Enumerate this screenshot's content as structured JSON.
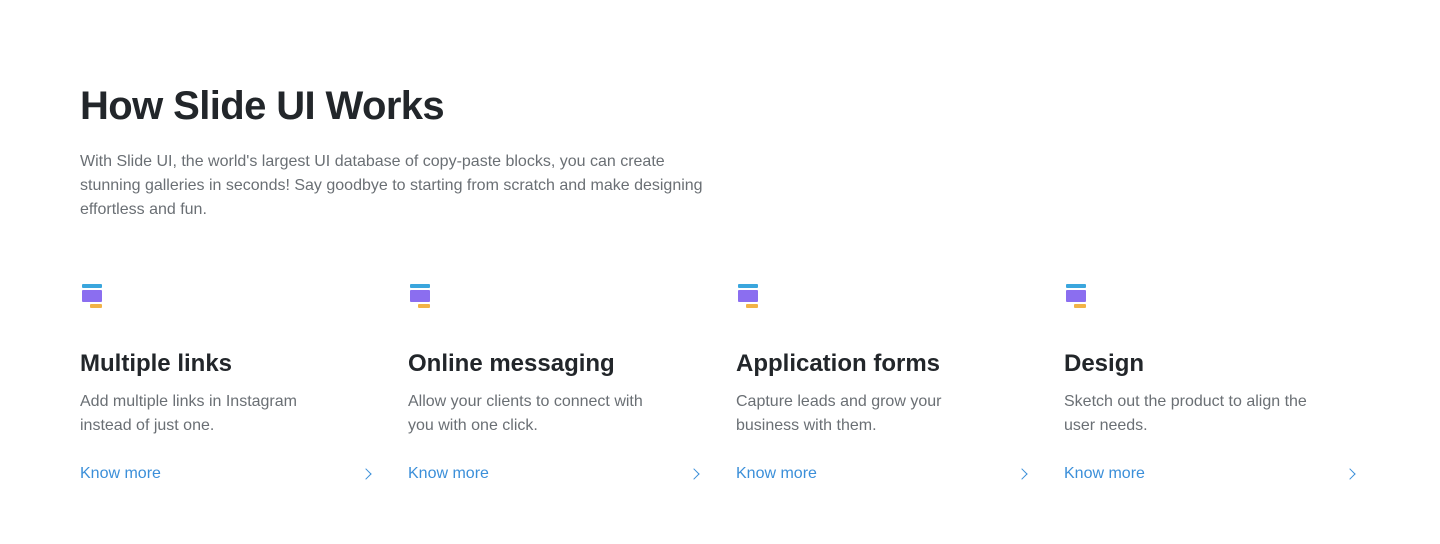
{
  "colors": {
    "link": "#3b8fd9",
    "icon_top": "#3aa6dd",
    "icon_block": "#8b6ef0",
    "icon_foot": "#f2b347"
  },
  "header": {
    "title": "How Slide UI Works",
    "description": "With Slide UI, the world's largest UI database of copy-paste blocks, you can create stunning galleries in seconds! Say goodbye to starting from scratch and make designing effortless and fun."
  },
  "features": [
    {
      "icon": "layout-blocks-icon",
      "title": "Multiple links",
      "description": "Add multiple links in Instagram instead of just one.",
      "link_label": "Know more"
    },
    {
      "icon": "layout-blocks-icon",
      "title": "Online messaging",
      "description": "Allow your clients to connect with you with one click.",
      "link_label": "Know more"
    },
    {
      "icon": "layout-blocks-icon",
      "title": "Application forms",
      "description": "Capture leads and grow your business with them.",
      "link_label": "Know more"
    },
    {
      "icon": "layout-blocks-icon",
      "title": "Design",
      "description": "Sketch out the product to align the user needs.",
      "link_label": "Know more"
    }
  ]
}
